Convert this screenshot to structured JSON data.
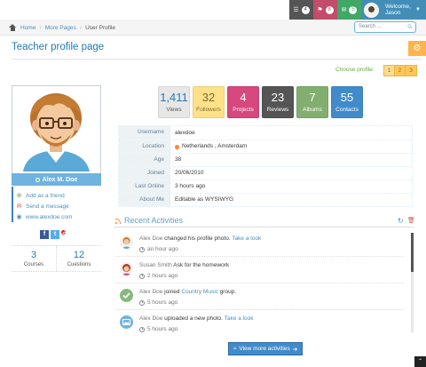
{
  "navbar": {
    "tasks_count": "4",
    "notifications_count": "8",
    "messages_count": "5",
    "user_welcome": "Welcome,",
    "user_name": "Jason"
  },
  "breadcrumbs": {
    "items": [
      "Home",
      "More Pages",
      "User Profile"
    ]
  },
  "search": {
    "placeholder": "Search ..."
  },
  "page": {
    "title": "Teacher profile page"
  },
  "choose_profile": {
    "label": "Choose profile:",
    "options": [
      "1",
      "2",
      "3"
    ]
  },
  "profile": {
    "name": "Alex M. Doe",
    "links": {
      "add_friend": "Add as a friend",
      "send_message": "Send a message",
      "website": "www.alexdoe.com"
    },
    "social": {
      "facebook": "f",
      "twitter": "t",
      "pinterest": "p"
    },
    "stats": [
      {
        "value": "3",
        "label": "Courses"
      },
      {
        "value": "12",
        "label": "Cuestions"
      }
    ]
  },
  "tiles": [
    {
      "value": "1,411",
      "label": "Views"
    },
    {
      "value": "32",
      "label": "Followers"
    },
    {
      "value": "4",
      "label": "Projects"
    },
    {
      "value": "23",
      "label": "Reviews"
    },
    {
      "value": "7",
      "label": "Albums"
    },
    {
      "value": "55",
      "label": "Contacts"
    }
  ],
  "info": [
    {
      "name": "Username",
      "value": "alexdoe"
    },
    {
      "name": "Location",
      "value": "Netherlands , Amsterdam"
    },
    {
      "name": "Age",
      "value": "38"
    },
    {
      "name": "Joined",
      "value": "20/06/2010"
    },
    {
      "name": "Last Online",
      "value": "3 hours ago"
    },
    {
      "name": "About Me",
      "value": "Editable as WYSIWYG"
    }
  ],
  "activities": {
    "title": "Recent Activities",
    "items": [
      {
        "user": "Alex Doe",
        "text": " changed his profile photo. ",
        "link": "Take a look",
        "time": "an hour ago"
      },
      {
        "user": "Susan Smith",
        "text": " Ask for the homework",
        "link": "",
        "time": "2 hours ago"
      },
      {
        "user": "Alex Doe",
        "text": " joined ",
        "link": "Country Music",
        "after": " group.",
        "time": "5 hours ago"
      },
      {
        "user": "Alex Doe",
        "text": " uploaded a new photo. ",
        "link": "Take a look",
        "time": "5 hours ago"
      }
    ],
    "view_more": "View more activities"
  },
  "colors": {
    "accent": "#438eb9",
    "title": "#2679b5",
    "link": "#4c8fbd"
  }
}
